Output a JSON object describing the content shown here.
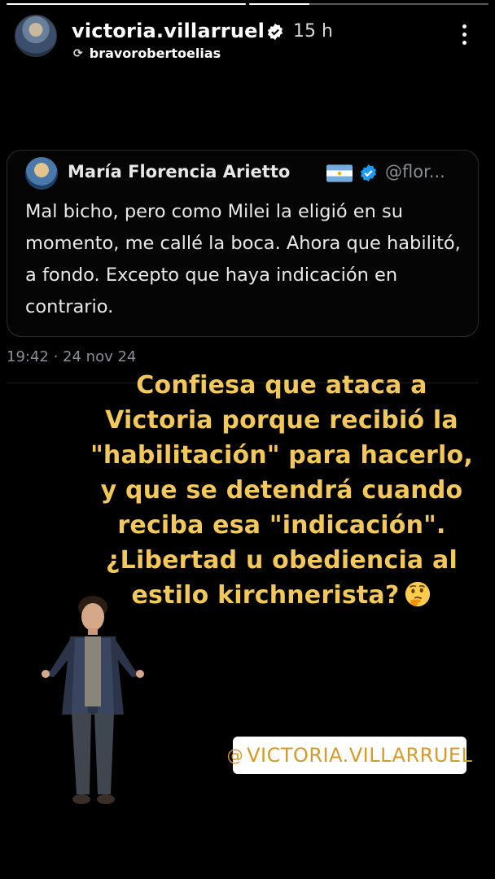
{
  "story": {
    "progress": [
      1,
      0.25
    ]
  },
  "header": {
    "username": "victoria.villarruel",
    "time": "15 h",
    "reposted_from": "bravorobertoelias"
  },
  "tweet": {
    "author_name": "María Florencia Arietto",
    "handle": "@flor...",
    "text": "Mal bicho, pero como Milei la eligió en su momento, me callé la boca. Ahora que habilitó, a fondo. Excepto que haya indicación en contrario.",
    "date": "19:42 · 24 nov 24"
  },
  "caption": {
    "text": "Confiesa que ataca a Victoria porque recibió la \"habilitación\" para hacerlo, y que se detendrá cuando reciba esa \"indicación\". ¿Libertad u obediencia al estilo kirchnerista?"
  },
  "mention": {
    "text": "VICTORIA.VILLARRUEL"
  },
  "colors": {
    "caption": "#f2c85b",
    "verified": "#1d9bf0",
    "mention_text": "#d49a2a"
  },
  "icons": [
    "verified-icon",
    "repost-icon",
    "more-icon",
    "argentina-flag-icon",
    "thinking-face-icon",
    "at-icon"
  ]
}
